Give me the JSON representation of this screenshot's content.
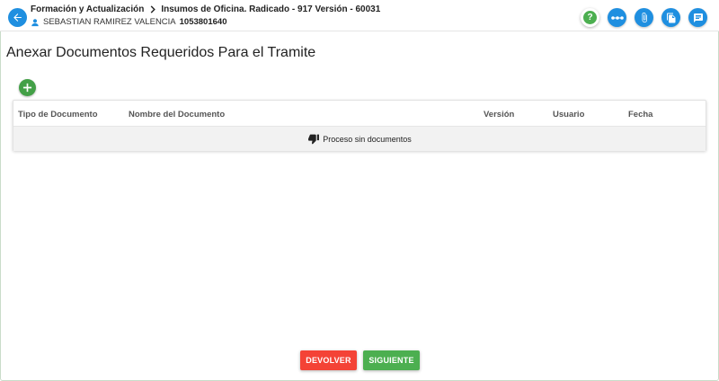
{
  "header": {
    "breadcrumb_1": "Formación y Actualización",
    "breadcrumb_2": "Insumos de Oficina. Radicado - 917 Versión - 60031",
    "user_name": "SEBASTIAN RAMIREZ VALENCIA",
    "user_id": "1053801640",
    "tools": [
      {
        "name": "help-icon",
        "label": "?"
      },
      {
        "name": "flow-icon"
      },
      {
        "name": "attach-icon"
      },
      {
        "name": "documents-icon"
      },
      {
        "name": "comments-icon"
      }
    ]
  },
  "main": {
    "title": "Anexar Documentos Requeridos Para el Tramite",
    "table": {
      "columns": [
        "Tipo de Documento",
        "Nombre del Documento",
        "Versión",
        "Usuario",
        "Fecha"
      ],
      "empty_text": "Proceso sin documentos"
    }
  },
  "actions": {
    "devolver_label": "DEVOLVER",
    "siguiente_label": "SIGUIENTE"
  },
  "colors": {
    "primary": "#1f8fe0",
    "success": "#4caf50",
    "danger": "#f44336"
  }
}
